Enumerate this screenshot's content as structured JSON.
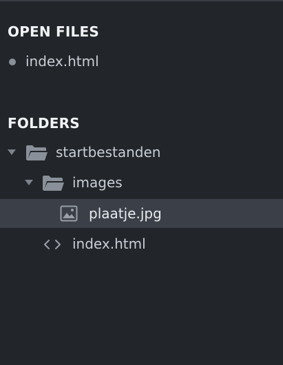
{
  "open_files": {
    "title": "OPEN FILES",
    "items": [
      {
        "label": "index.html",
        "icon": "dot-icon"
      }
    ]
  },
  "folders": {
    "title": "FOLDERS",
    "tree": [
      {
        "label": "startbestanden",
        "icon": "folder-open-icon",
        "expanded": true,
        "depth": 0
      },
      {
        "label": "images",
        "icon": "folder-open-icon",
        "expanded": true,
        "depth": 1
      },
      {
        "label": "plaatje.jpg",
        "icon": "image-file-icon",
        "selected": true,
        "depth": 2
      },
      {
        "label": "index.html",
        "icon": "code-file-icon",
        "depth": 1
      }
    ]
  },
  "colors": {
    "background": "#22262b",
    "selected_row": "#3a3f48",
    "text": "#c9ced6",
    "heading": "#f1f3f5",
    "icon": "#8a9099"
  }
}
